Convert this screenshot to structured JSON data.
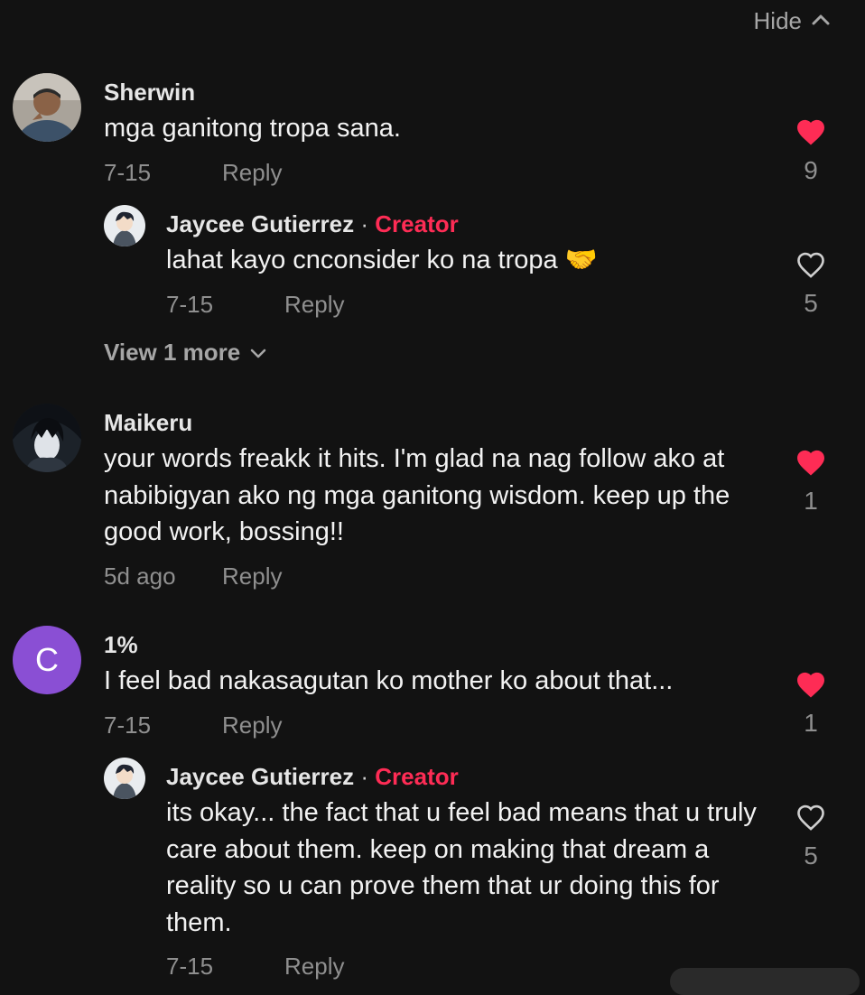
{
  "hide": {
    "label": "Hide",
    "icon": "chevron-up-icon"
  },
  "comments": [
    {
      "username": "Sherwin",
      "text": "mga ganitong tropa sana.",
      "date": "7-15",
      "reply_label": "Reply",
      "likes": "9",
      "liked": true
    },
    {
      "username": "Jaycee Gutierrez",
      "separator": "·",
      "badge": "Creator",
      "text": "lahat kayo cnconsider ko na tropa 🤝",
      "date": "7-15",
      "reply_label": "Reply",
      "likes": "5",
      "liked": false
    },
    {
      "username": "Maikeru",
      "text": "your words freakk it hits. I'm glad na nag follow ako at nabibigyan ako ng mga ganitong wisdom. keep up the good work, bossing!!",
      "date": "5d ago",
      "reply_label": "Reply",
      "likes": "1",
      "liked": true
    },
    {
      "username": "1%",
      "avatar_letter": "C",
      "text": "I feel bad nakasagutan ko mother ko about that...",
      "date": "7-15",
      "reply_label": "Reply",
      "likes": "1",
      "liked": true
    },
    {
      "username": "Jaycee Gutierrez",
      "separator": "·",
      "badge": "Creator",
      "text": "its okay... the fact that u feel bad means that u truly care about them. keep on making that dream a reality so u can prove them that ur doing this for them.",
      "date": "7-15",
      "reply_label": "Reply",
      "likes": "5",
      "liked": false
    }
  ],
  "view_more": {
    "label": "View 1 more",
    "icon": "chevron-down-icon"
  },
  "colors": {
    "background": "#121212",
    "liked_heart": "#fe2c55",
    "creator_badge": "#fe2c55",
    "letter_avatar": "#8a4fd4",
    "muted_text": "#8f8f8f"
  }
}
